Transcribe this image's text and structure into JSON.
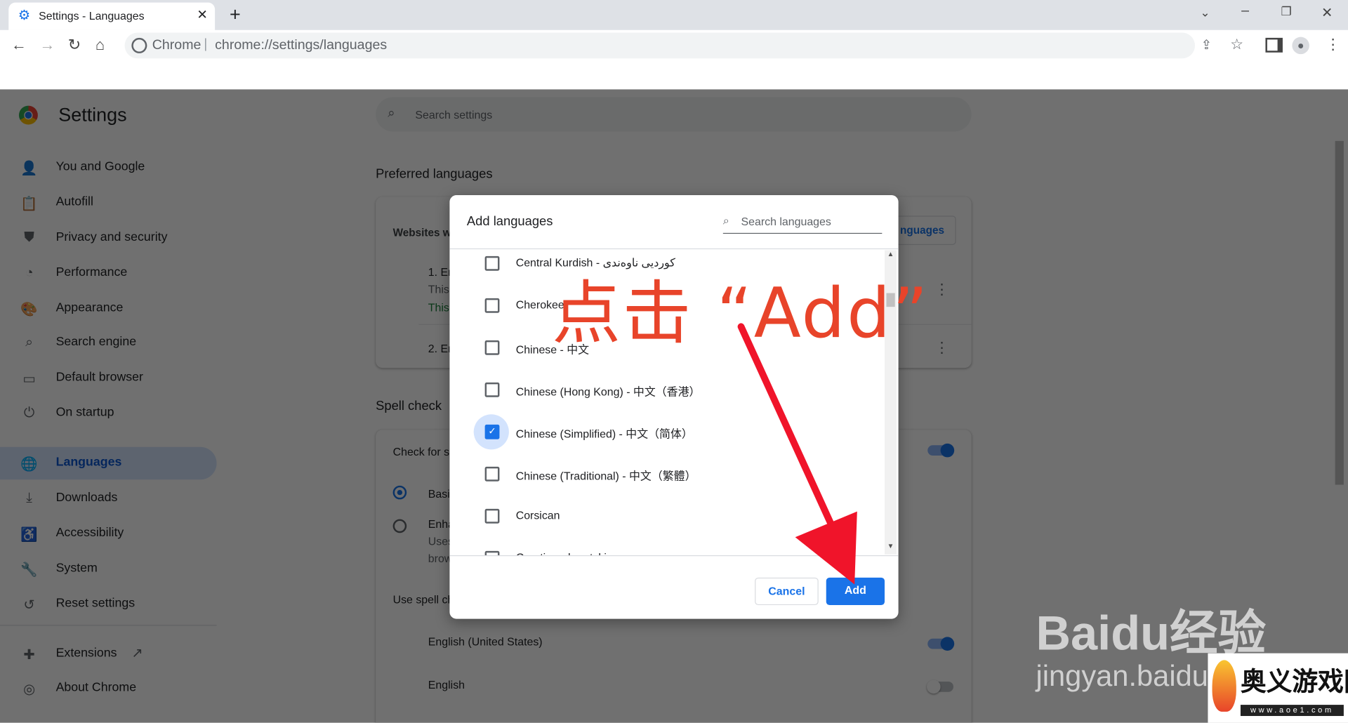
{
  "browser": {
    "tab_title": "Settings - Languages",
    "omnibox_site": "Chrome",
    "omnibox_url": "chrome://settings/languages"
  },
  "settings": {
    "title": "Settings",
    "search_placeholder": "Search settings",
    "sidebar": [
      {
        "label": "You and Google",
        "icon": "person-icon"
      },
      {
        "label": "Autofill",
        "icon": "clipboard-icon"
      },
      {
        "label": "Privacy and security",
        "icon": "shield-icon"
      },
      {
        "label": "Performance",
        "icon": "speedometer-icon"
      },
      {
        "label": "Appearance",
        "icon": "palette-icon"
      },
      {
        "label": "Search engine",
        "icon": "search-icon"
      },
      {
        "label": "Default browser",
        "icon": "browser-icon"
      },
      {
        "label": "On startup",
        "icon": "power-icon"
      },
      {
        "label": "Languages",
        "icon": "globe-icon",
        "active": true
      },
      {
        "label": "Downloads",
        "icon": "download-icon"
      },
      {
        "label": "Accessibility",
        "icon": "accessibility-icon"
      },
      {
        "label": "System",
        "icon": "wrench-icon"
      },
      {
        "label": "Reset settings",
        "icon": "history-icon"
      },
      {
        "label": "Extensions",
        "icon": "puzzle-icon"
      },
      {
        "label": "About Chrome",
        "icon": "chrome-icon"
      }
    ],
    "preferred_languages": {
      "heading": "Preferred languages",
      "websites_label": "Websites w",
      "add_button": "nguages",
      "item1": "1. En",
      "item1_sub": "This",
      "item1_sub2": "This",
      "item2": "2. En"
    },
    "spell_check": {
      "heading": "Spell check",
      "check_label": "Check for s",
      "check_on": true,
      "basic": "Basi",
      "enhanced": "Enha",
      "enhanced_sub1": "Uses",
      "enhanced_sub2": "brow",
      "use_label": "Use spell ch",
      "lang1": "English (United States)",
      "lang1_on": true,
      "lang2": "English",
      "lang2_on": false
    }
  },
  "dialog": {
    "title": "Add languages",
    "search_placeholder": "Search languages",
    "languages": [
      {
        "label": "Central Kurdish - کوردیی ناوەندی",
        "checked": false
      },
      {
        "label": "Cherokee",
        "checked": false
      },
      {
        "label": "Chinese - 中文",
        "checked": false
      },
      {
        "label": "Chinese (Hong Kong) - 中文（香港）",
        "checked": false
      },
      {
        "label": "Chinese (Simplified) - 中文（简体）",
        "checked": true
      },
      {
        "label": "Chinese (Traditional) - 中文（繁體）",
        "checked": false
      },
      {
        "label": "Corsican",
        "checked": false
      },
      {
        "label": "Croatian - hrvatski",
        "checked": false
      }
    ],
    "cancel": "Cancel",
    "add": "Add"
  },
  "annotation": {
    "text": "点击 “Add”",
    "color": "#e8442a",
    "arrow_color": "#f0142a"
  },
  "watermarks": {
    "baidu": "Baidu经验",
    "baidu_url": "jingyan.baidu",
    "aoe": "奥义游戏网",
    "aoe_url": "www.aoe1.com"
  },
  "colors": {
    "accent": "#1a73e8",
    "active_bg": "#d3e3fd"
  }
}
